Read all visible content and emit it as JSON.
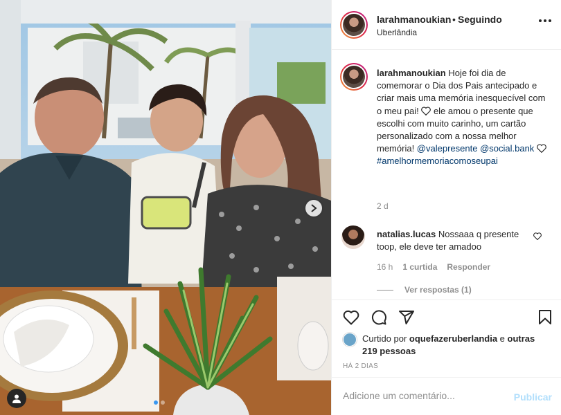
{
  "post": {
    "photo": {
      "alt_semantic": "family-photo",
      "carousel_total": 2,
      "carousel_active": 0
    },
    "header": {
      "username": "larahmanoukian",
      "dot": "•",
      "follow_status": "Seguindo",
      "location": "Uberlândia"
    },
    "caption": {
      "username": "larahmanoukian",
      "text_1": "Hoje foi dia de comemorar o Dia dos Pais antecipado e criar mais uma memória inesquecível com o meu pai! ",
      "text_2": " ele amou o presente que escolhi com muito carinho, um cartão personalizado com a nossa melhor memória! ",
      "mention_1": "@valepresente",
      "mention_2": "@social.bank",
      "hashtag": "#amelhormemoriacomoseupai",
      "time": "2 d"
    },
    "comment": {
      "username": "natalias.lucas",
      "text": "Nossaaa q presente toop, ele deve ter amadoo",
      "time": "16 h",
      "likes": "1 curtida",
      "reply": "Responder",
      "view_replies": "Ver respostas (1)"
    },
    "likes": {
      "prefix": "Curtido por ",
      "user": "oquefazeruberlandia",
      "connector": " e ",
      "others": "outras 219 pessoas"
    },
    "date": "HÁ 2 DIAS",
    "add_comment": {
      "placeholder": "Adicione um comentário...",
      "publish": "Publicar"
    }
  },
  "colors": {
    "accent": "#3897f0",
    "link": "#00376b",
    "muted": "#8e8e8e",
    "publish_disabled": "#b2dffc"
  }
}
